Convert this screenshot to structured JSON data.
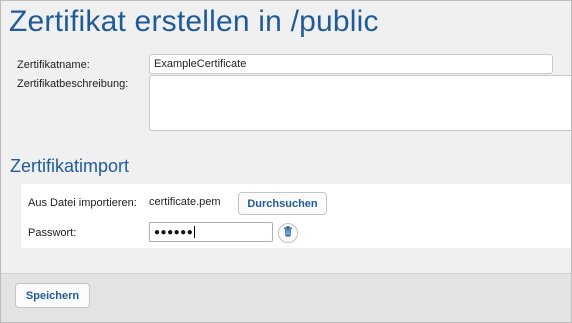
{
  "page": {
    "title": "Zertifikat erstellen in /public"
  },
  "form": {
    "name_label": "Zertifikatname:",
    "name_value": "ExampleCertificate",
    "description_label": "Zertifikatbeschreibung:",
    "description_value": ""
  },
  "import": {
    "section_title": "Zertifikatimport",
    "file_label": "Aus Datei importieren:",
    "file_value": "certificate.pem",
    "browse_label": "Durchsuchen",
    "password_label": "Passwort:",
    "password_masked": "●●●●●●"
  },
  "footer": {
    "save_label": "Speichern"
  },
  "icons": {
    "delete": "trash-icon"
  },
  "colors": {
    "accent": "#1f5b99",
    "footer": "#e3e3e3"
  }
}
